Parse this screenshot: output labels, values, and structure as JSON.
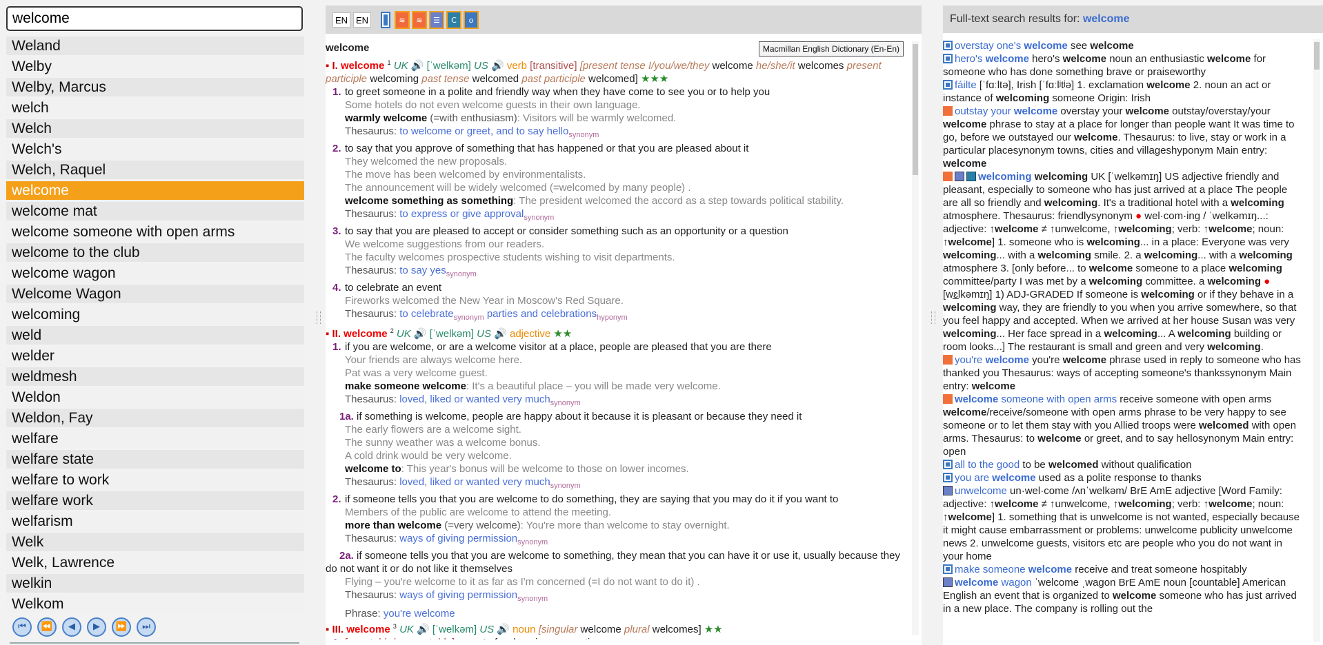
{
  "search": {
    "value": "welcome"
  },
  "wordlist": [
    "Weland",
    "Welby",
    "Welby, Marcus",
    "welch",
    "Welch",
    "Welch's",
    "Welch, Raquel",
    "welcome",
    "welcome mat",
    "welcome someone with open arms",
    "welcome to the club",
    "welcome wagon",
    "Welcome Wagon",
    "welcoming",
    "weld",
    "welder",
    "weldmesh",
    "Weldon",
    "Weldon, Fay",
    "welfare",
    "welfare state",
    "welfare to work",
    "welfare work",
    "welfarism",
    "Welk",
    "Welk, Lawrence",
    "welkin",
    "Welkom"
  ],
  "selected_index": 7,
  "nav_buttons": [
    "first-icon",
    "prev-page-icon",
    "prev-icon",
    "next-icon",
    "next-page-icon",
    "last-icon"
  ],
  "nav_glyphs": [
    "⏮",
    "⏪",
    "◀",
    "▶",
    "⏩",
    "⏭"
  ],
  "toolbar": {
    "lang_from": "EN",
    "lang_to": "EN"
  },
  "article": {
    "headword": "welcome",
    "dict_name": "Macmillan English Dictionary (En-En)"
  },
  "results": {
    "header_prefix": "Full-text search results for:",
    "query": "welcome"
  },
  "colors": {
    "accent": "#f5a019",
    "link": "#3a6bd0",
    "headword_red": "#e00000"
  }
}
